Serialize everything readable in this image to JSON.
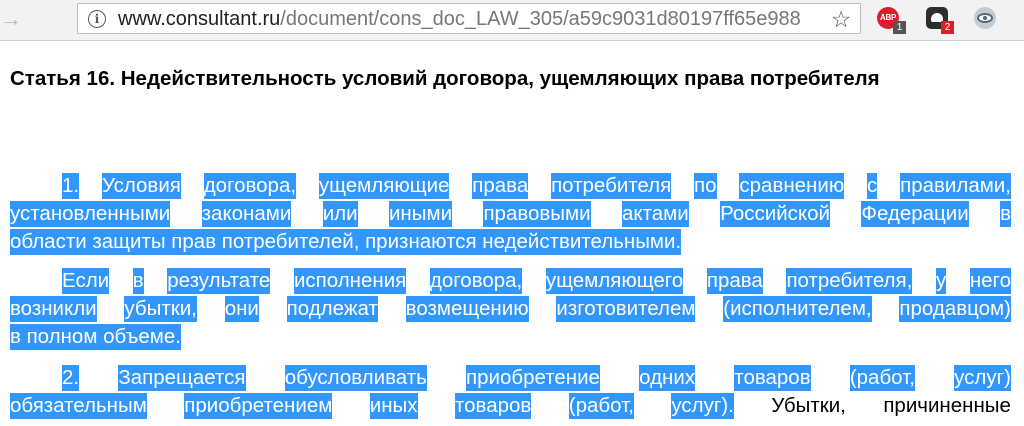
{
  "browser": {
    "url_domain": "www.consultant.ru",
    "url_path": "/document/cons_doc_LAW_305/a59c9031d80197ff65e988",
    "forward_arrow": "→",
    "info_symbol": "i",
    "star_symbol": "☆",
    "extensions": {
      "adblock_label": "ABP",
      "adblock_badge": "1",
      "ghostery_badge": "2"
    }
  },
  "document": {
    "heading": "Статья 16. Недействительность условий договора, ущемляющих права потребителя",
    "paragraph_1": {
      "lines": [
        "1. Условия договора, ущемляющие права потребителя по сравнению с правилами,",
        "установленными законами или иными правовыми актами Российской Федерации в",
        "области защиты прав потребителей, признаются недействительными."
      ]
    },
    "paragraph_2": {
      "lines": [
        "Если в результате исполнения договора, ущемляющего права потребителя, у него",
        "возникли убытки, они подлежат возмещению изготовителем (исполнителем, продавцом)",
        "в полном объеме."
      ]
    },
    "paragraph_3": {
      "line_1": "2. Запрещается обусловливать приобретение одних товаров (работ, услуг)",
      "line_2_selected": "обязательным приобретением иных товаров (работ, услуг).",
      "line_2_rest": "Убытки, причиненные"
    }
  }
}
